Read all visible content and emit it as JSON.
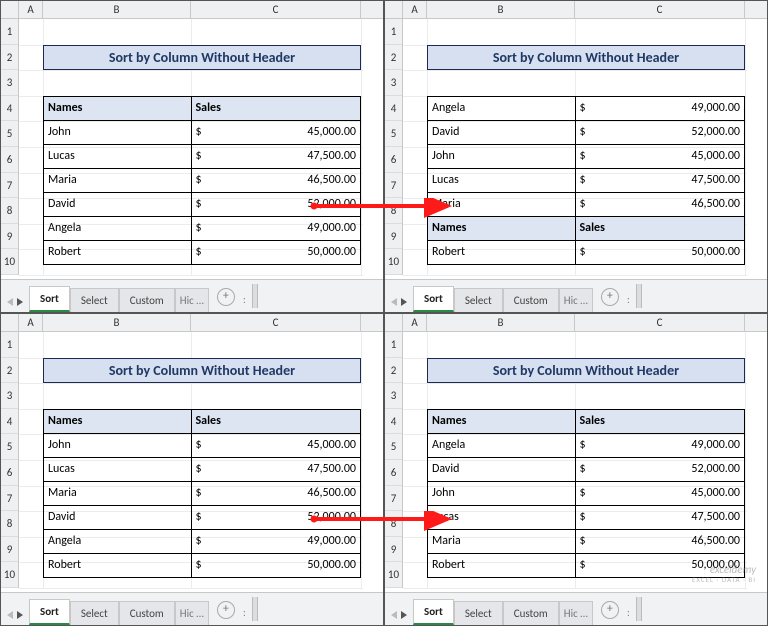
{
  "title": "Sort by Column Without Header",
  "columns": {
    "letters": [
      "A",
      "B",
      "C"
    ],
    "rowNums": [
      "1",
      "2",
      "3",
      "4",
      "5",
      "6",
      "7",
      "8",
      "9",
      "10"
    ]
  },
  "header": {
    "names": "Names",
    "sales": "Sales"
  },
  "currency": "$",
  "panes": {
    "topLeft": {
      "rows": [
        {
          "kind": "header",
          "name": "Names",
          "sales": "Sales"
        },
        {
          "kind": "data",
          "name": "John",
          "amount": "45,000.00"
        },
        {
          "kind": "data",
          "name": "Lucas",
          "amount": "47,500.00"
        },
        {
          "kind": "data",
          "name": "Maria",
          "amount": "46,500.00"
        },
        {
          "kind": "data",
          "name": "David",
          "amount": "52,000.00"
        },
        {
          "kind": "data",
          "name": "Angela",
          "amount": "49,000.00"
        },
        {
          "kind": "data",
          "name": "Robert",
          "amount": "50,000.00"
        }
      ]
    },
    "topRight": {
      "rows": [
        {
          "kind": "data",
          "name": "Angela",
          "amount": "49,000.00"
        },
        {
          "kind": "data",
          "name": "David",
          "amount": "52,000.00"
        },
        {
          "kind": "data",
          "name": "John",
          "amount": "45,000.00"
        },
        {
          "kind": "data",
          "name": "Lucas",
          "amount": "47,500.00"
        },
        {
          "kind": "data",
          "name": "Maria",
          "amount": "46,500.00"
        },
        {
          "kind": "header",
          "name": "Names",
          "sales": "Sales"
        },
        {
          "kind": "data",
          "name": "Robert",
          "amount": "50,000.00"
        }
      ]
    },
    "bottomLeft": {
      "rows": [
        {
          "kind": "header",
          "name": "Names",
          "sales": "Sales"
        },
        {
          "kind": "data",
          "name": "John",
          "amount": "45,000.00"
        },
        {
          "kind": "data",
          "name": "Lucas",
          "amount": "47,500.00"
        },
        {
          "kind": "data",
          "name": "Maria",
          "amount": "46,500.00"
        },
        {
          "kind": "data",
          "name": "David",
          "amount": "52,000.00"
        },
        {
          "kind": "data",
          "name": "Angela",
          "amount": "49,000.00"
        },
        {
          "kind": "data",
          "name": "Robert",
          "amount": "50,000.00"
        }
      ]
    },
    "bottomRight": {
      "rows": [
        {
          "kind": "header",
          "name": "Names",
          "sales": "Sales"
        },
        {
          "kind": "data",
          "name": "Angela",
          "amount": "49,000.00"
        },
        {
          "kind": "data",
          "name": "David",
          "amount": "52,000.00"
        },
        {
          "kind": "data",
          "name": "John",
          "amount": "45,000.00"
        },
        {
          "kind": "data",
          "name": "Lucas",
          "amount": "47,500.00"
        },
        {
          "kind": "data",
          "name": "Maria",
          "amount": "46,500.00"
        },
        {
          "kind": "data",
          "name": "Robert",
          "amount": "50,000.00"
        }
      ]
    }
  },
  "tabs": {
    "active": "Sort",
    "others": [
      "Select",
      "Custom"
    ],
    "truncated": "Hic …"
  },
  "watermark": {
    "brand": "exceldemy",
    "tagline": "EXCEL · DATA · BI"
  }
}
